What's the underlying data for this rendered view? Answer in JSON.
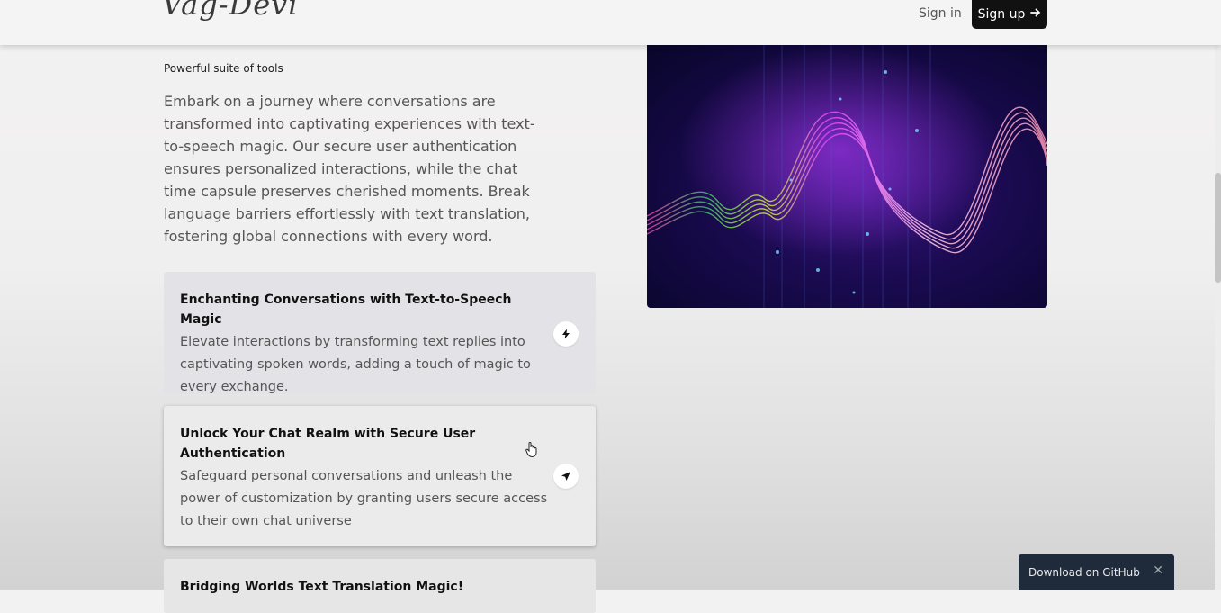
{
  "header": {
    "logo": "Vag-Devi",
    "signin_label": "Sign in",
    "signup_label": "Sign up",
    "signup_icon": "arrow-right-icon"
  },
  "section": {
    "eyebrow": "Powerful suite of tools",
    "intro": "Embark on a journey where conversations are transformed into captivating experiences with text-to-speech magic. Our secure user authentication ensures personalized interactions, while the chat time capsule preserves cherished moments. Break language barriers effortlessly with text translation, fostering global connections with every word."
  },
  "features": [
    {
      "title": "Enchanting Conversations with Text-to-Speech Magic",
      "description": "Elevate interactions by transforming text replies into captivating spoken words, adding a touch of magic to every exchange.",
      "icon": "lightning-icon"
    },
    {
      "title": "Unlock Your Chat Realm with Secure User Authentication",
      "description": "Safeguard personal conversations and unleash the power of customization by granting users secure access to their own chat universe",
      "icon": "send-arrow-icon"
    },
    {
      "title": "Bridging Worlds Text Translation Magic!",
      "description": ""
    }
  ],
  "toast": {
    "label": "Download on GitHub",
    "close": "✕"
  },
  "colors": {
    "signup_bg": "#111111",
    "toast_bg": "#1f2a3a",
    "wave_magenta": "#e040fb",
    "wave_pink": "#f48fb1",
    "wave_green": "#c6e23a"
  }
}
